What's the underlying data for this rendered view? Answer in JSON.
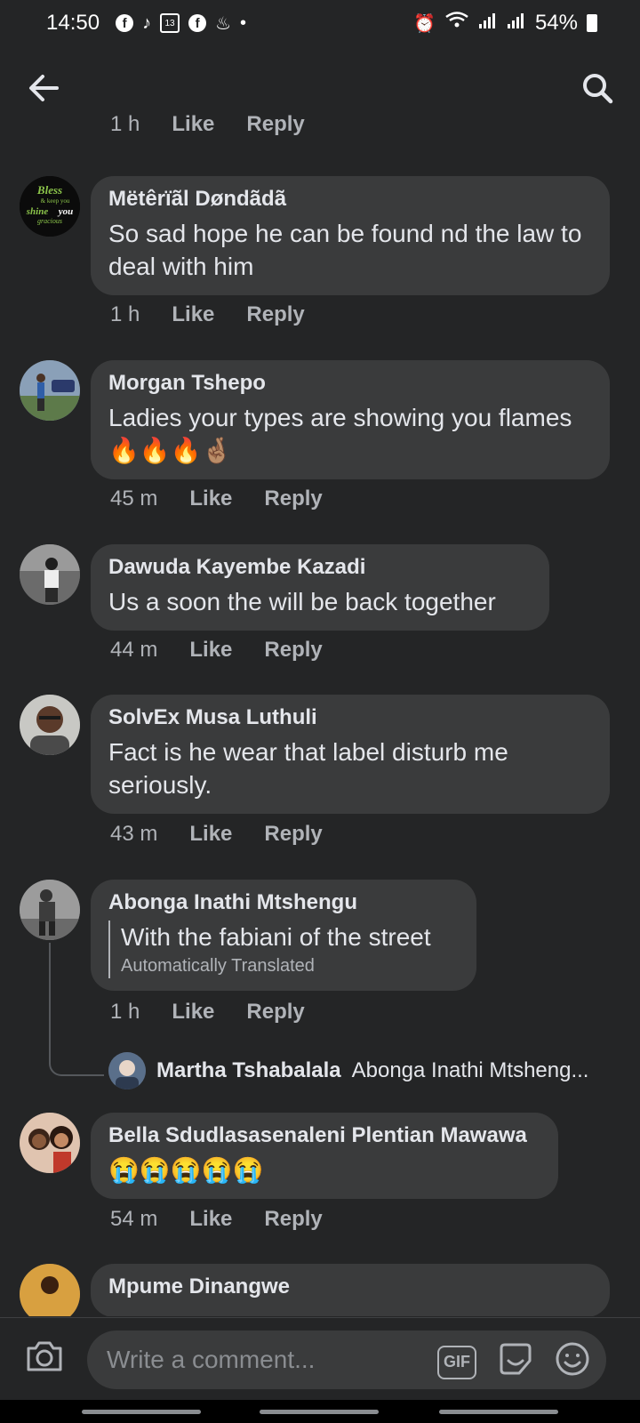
{
  "status_bar": {
    "time": "14:50",
    "battery": "54%",
    "icons": [
      "facebook-icon",
      "tiktok-icon",
      "calendar-icon",
      "facebook-icon",
      "notification-icon",
      "dot-icon",
      "alarm-icon",
      "wifi-icon",
      "signal-icon",
      "signal-icon",
      "battery-icon"
    ],
    "calendar_day": "13"
  },
  "header": {
    "back": "back-arrow-icon",
    "search": "search-icon"
  },
  "top_meta": {
    "time": "1 h",
    "like": "Like",
    "reply": "Reply"
  },
  "comments": [
    {
      "author": "Mëtêrïãl Døndãdã",
      "text": "So sad hope he can be found nd the law to deal with him",
      "time": "1 h",
      "like": "Like",
      "reply": "Reply"
    },
    {
      "author": "Morgan Tshepo",
      "text": "Ladies your types are showing you flames 🔥🔥🔥🤞🏽",
      "time": "45 m",
      "like": "Like",
      "reply": "Reply"
    },
    {
      "author": "Dawuda Kayembe Kazadi",
      "text": "Us a soon  the will be back together",
      "time": "44 m",
      "like": "Like",
      "reply": "Reply"
    },
    {
      "author": "SolvEx Musa Luthuli",
      "text": "Fact is he wear that label disturb me seriously.",
      "time": "43 m",
      "like": "Like",
      "reply": "Reply"
    },
    {
      "author": "Abonga Inathi Mtshengu",
      "text": "With the fabiani of the street",
      "translated": "Automatically Translated",
      "time": "1 h",
      "like": "Like",
      "reply": "Reply"
    },
    {
      "author": "Bella Sdudlasasenaleni Plentian Mawawa",
      "text": "😭😭😭😭😭",
      "time": "54 m",
      "like": "Like",
      "reply": "Reply"
    },
    {
      "author": "Mpume Dinangwe"
    }
  ],
  "reply_preview": {
    "author": "Martha Tshabalala",
    "text": "Abonga Inathi Mtsheng..."
  },
  "avatar_text": {
    "line1": "Bless",
    "line2": "& keep you",
    "line3": "shine",
    "line4": "you",
    "line5": "gracious"
  },
  "composer": {
    "placeholder": "Write a comment...",
    "gif": "GIF"
  }
}
